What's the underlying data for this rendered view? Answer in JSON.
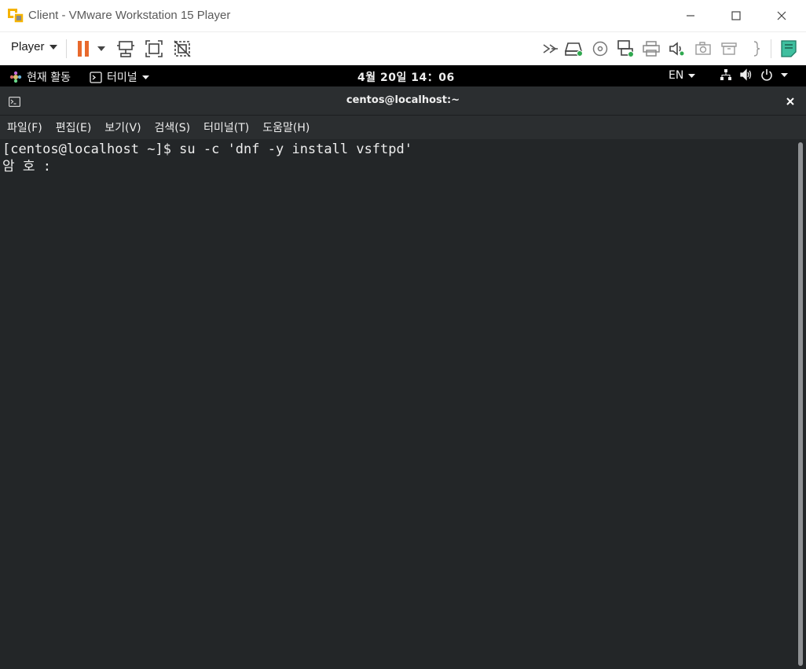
{
  "vmware": {
    "window_title": "Client - VMware Workstation 15 Player",
    "toolbar": {
      "player_menu_label": "Player"
    },
    "icons": {
      "app": "vmware-icon",
      "minimize": "minimize-icon",
      "maximize": "maximize-icon",
      "close": "close-icon",
      "pause": "pause-icon",
      "send_keys": "send-ctrl-alt-del-icon",
      "fit_guest": "fit-guest-icon",
      "unity": "unity-icon"
    },
    "colors": {
      "pause": "#e8692c",
      "accent_green": "#2fa84f",
      "teal_note": "#3fbf9f"
    }
  },
  "gnome": {
    "activities_label": "현재 활동",
    "app_menu_label": "터미널",
    "clock": "4월 20일  14：06",
    "language": "EN"
  },
  "terminal": {
    "window_title": "centos@localhost:~",
    "menu": [
      "파일(F)",
      "편집(E)",
      "보기(V)",
      "검색(S)",
      "터미널(T)",
      "도움말(H)"
    ],
    "lines": [
      "[centos@localhost ~]$ su -c 'dnf -y install vsftpd'",
      "암 호 :"
    ]
  }
}
